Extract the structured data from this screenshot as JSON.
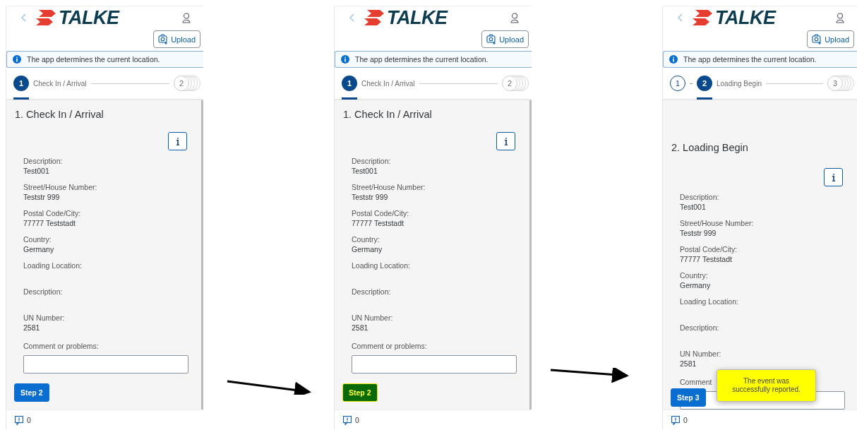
{
  "screens": [
    {
      "logo": "TALKE",
      "upload": "Upload",
      "info": "The app determines the current location.",
      "steps": [
        {
          "number": "1",
          "label": "Check In / Arrival",
          "kind": "current"
        },
        {
          "number": "2",
          "kind": "upcoming"
        }
      ],
      "title": "1. Check In / Arrival",
      "fields": [
        {
          "label": "Description:",
          "value": "Test001"
        },
        {
          "label": "Street/House Number:",
          "value": "Teststr 999"
        },
        {
          "label": "Postal Code/City:",
          "value": "77777 Teststadt"
        },
        {
          "label": "Country:",
          "value": "Germany"
        },
        {
          "label": "Loading Location:"
        },
        {
          "label": "Description:"
        },
        {
          "label": "UN Number:",
          "value": "2581"
        }
      ],
      "comment_label": "Comment or problems:",
      "button": {
        "label": "Step 2",
        "focused": false
      },
      "messages": "0"
    },
    {
      "logo": "TALKE",
      "upload": "Upload",
      "info": "The app determines the current location.",
      "steps": [
        {
          "number": "1",
          "label": "Check In / Arrival",
          "kind": "current"
        },
        {
          "number": "2",
          "kind": "upcoming"
        }
      ],
      "title": "1. Check In / Arrival",
      "fields": [
        {
          "label": "Description:",
          "value": "Test001"
        },
        {
          "label": "Street/House Number:",
          "value": "Teststr 999"
        },
        {
          "label": "Postal Code/City:",
          "value": "77777 Teststadt"
        },
        {
          "label": "Country:",
          "value": "Germany"
        },
        {
          "label": "Loading Location:"
        },
        {
          "label": "Description:"
        },
        {
          "label": "UN Number:",
          "value": "2581"
        }
      ],
      "comment_label": "Comment or problems:",
      "button": {
        "label": "Step 2",
        "focused": true
      },
      "messages": "0"
    },
    {
      "logo": "TALKE",
      "upload": "Upload",
      "info": "The app determines the current location.",
      "steps": [
        {
          "number": "1",
          "kind": "completed"
        },
        {
          "number": "2",
          "label": "Loading Begin",
          "kind": "current"
        },
        {
          "number": "3",
          "kind": "upcoming"
        }
      ],
      "title": "2. Loading Begin",
      "fields": [
        {
          "label": "Description:",
          "value": "Test001"
        },
        {
          "label": "Street/House Number:",
          "value": "Teststr 999"
        },
        {
          "label": "Postal Code/City:",
          "value": "77777 Teststadt"
        },
        {
          "label": "Country:",
          "value": "Germany"
        },
        {
          "label": "Loading Location:"
        },
        {
          "label": "Description:"
        },
        {
          "label": "UN Number:",
          "value": "2581"
        }
      ],
      "comment_label": "Comment",
      "button": {
        "label": "Step 3",
        "focused": false
      },
      "messages": "0",
      "toast": "The event was successfully reported."
    }
  ]
}
